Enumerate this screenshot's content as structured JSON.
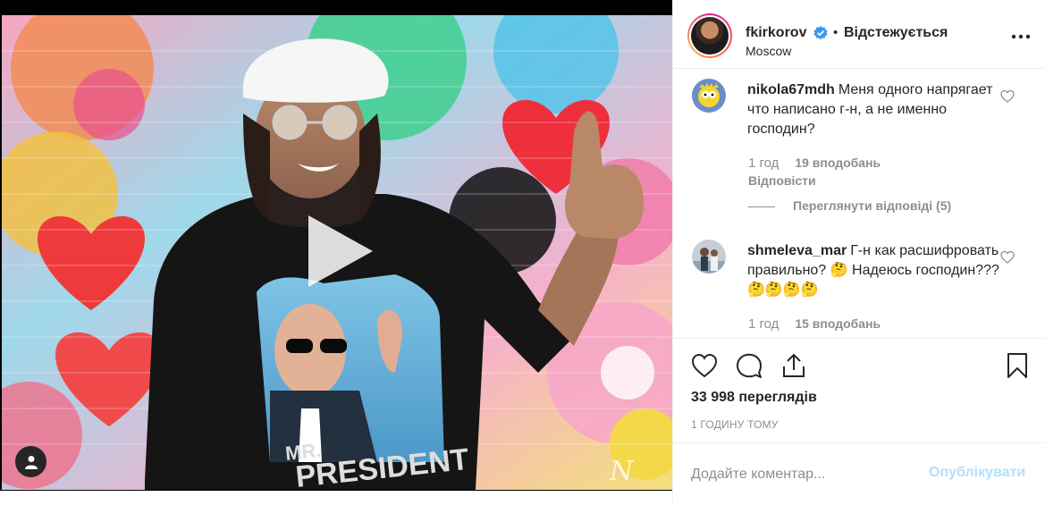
{
  "post": {
    "username": "fkirkorov",
    "follow_separator": "•",
    "follow_state": "Відстежується",
    "location": "Moscow",
    "shirt_text_line1": "MR.",
    "shirt_text_line2": "PRESIDENT",
    "signature_mark": "N"
  },
  "comments": [
    {
      "username": "nikola67mdh",
      "text": "Меня одного напрягает что написано г-н, а не именно господин?",
      "time": "1 год",
      "likes": "19 вподобань",
      "reply_label": "Відповісти",
      "view_replies": "Переглянути відповіді (5)"
    },
    {
      "username": "shmeleva_mar",
      "text": "Г-н как расшифровать правильно? 🤔 Надеюсь господин??? 🤔🤔🤔🤔",
      "time": "1 год",
      "likes": "15 вподобань"
    }
  ],
  "actions": {
    "views": "33 998 переглядів",
    "timestamp": "1 ГОДИНУ ТОМУ"
  },
  "comment_box": {
    "placeholder": "Додайте коментар...",
    "publish_label": "Опублікувати"
  },
  "icons": {
    "like": "heart-icon",
    "comment": "comment-bubble-icon",
    "share": "share-icon",
    "save": "bookmark-icon",
    "more": "more-dots-icon",
    "play": "play-icon",
    "tags": "person-icon",
    "verified": "verified-badge-icon"
  },
  "colors": {
    "text": "#262626",
    "secondary": "#8e8e8e",
    "link_blue": "#b2dffc",
    "verified_blue": "#3897f0",
    "border": "#efefef"
  }
}
